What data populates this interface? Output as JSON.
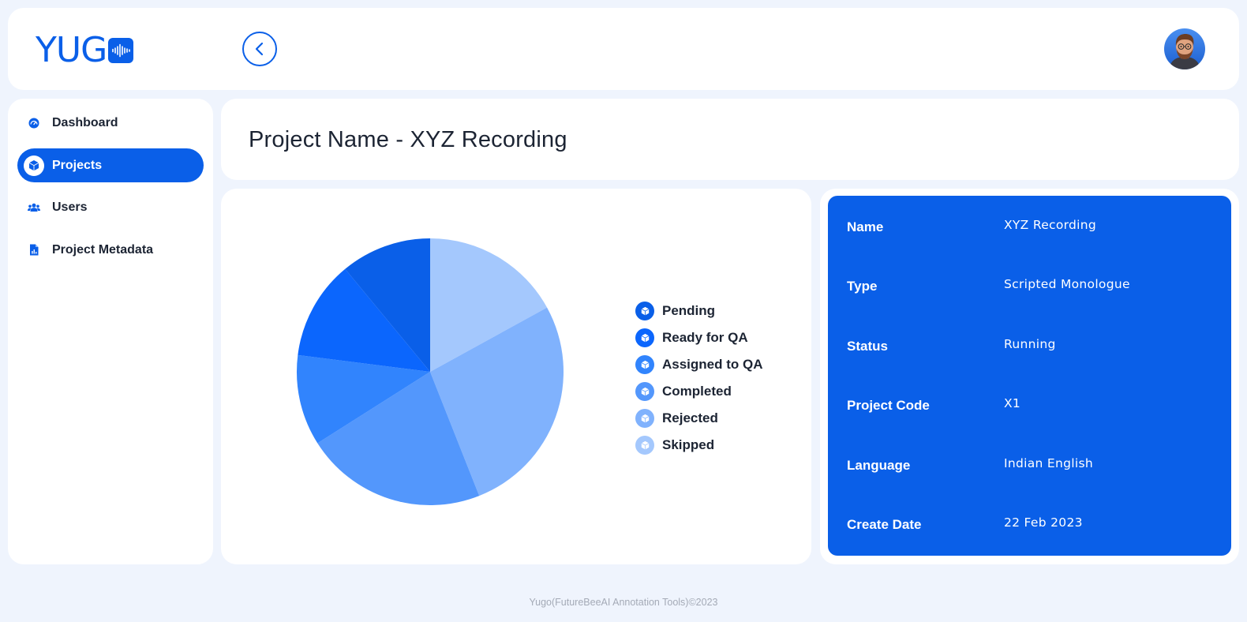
{
  "brand": {
    "logo_text": "YUG",
    "accent": "#0a5fe8"
  },
  "header": {
    "back_icon": "chevron-left-icon",
    "avatar_icon": "user-avatar"
  },
  "sidebar": {
    "items": [
      {
        "label": "Dashboard",
        "icon": "speedometer-icon",
        "active": false
      },
      {
        "label": "Projects",
        "icon": "cube-icon",
        "active": true
      },
      {
        "label": "Users",
        "icon": "users-icon",
        "active": false
      },
      {
        "label": "Project Metadata",
        "icon": "document-chart-icon",
        "active": false
      }
    ]
  },
  "main": {
    "title": "Project Name - XYZ Recording"
  },
  "chart_data": {
    "type": "pie",
    "categories": [
      "Pending",
      "Ready for QA",
      "Assigned to QA",
      "Completed",
      "Rejected",
      "Skipped"
    ],
    "values": [
      11,
      12,
      11,
      22,
      27,
      17
    ],
    "colors": [
      "#0a5fe8",
      "#0b66fd",
      "#3184fd",
      "#5397fc",
      "#80b2fd",
      "#a4c8fd"
    ],
    "legend_position": "right"
  },
  "info": {
    "rows": [
      {
        "key": "Name",
        "value": "XYZ Recording"
      },
      {
        "key": "Type",
        "value": "Scripted Monologue"
      },
      {
        "key": "Status",
        "value": "Running"
      },
      {
        "key": "Project Code",
        "value": "X1"
      },
      {
        "key": "Language",
        "value": "Indian English"
      },
      {
        "key": "Create Date",
        "value": "22 Feb 2023"
      }
    ]
  },
  "footer": {
    "text": "Yugo(FutureBeeAI Annotation Tools)©2023"
  }
}
